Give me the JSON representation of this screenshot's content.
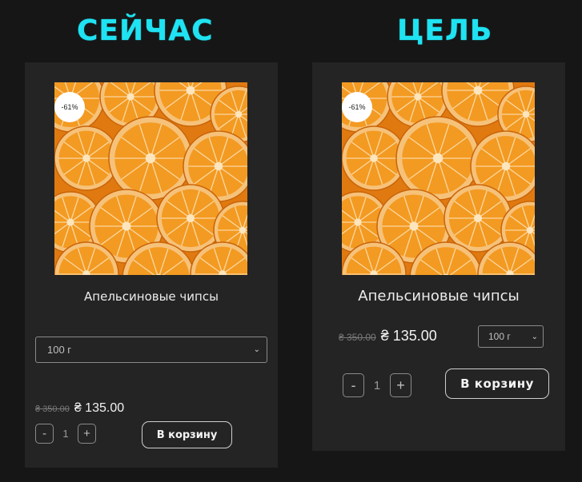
{
  "headings": {
    "now": "СЕЙЧАС",
    "goal": "ЦЕЛЬ"
  },
  "colors": {
    "background": "#161616",
    "card": "#242424",
    "heading": "#1fe3f2",
    "image_fill": "#f08a1a"
  },
  "card_now": {
    "image_icon": "dried-orange-slices-photo",
    "badge": "-61%",
    "title": "Апельсиновые чипсы",
    "select_value": "100 г",
    "old_price": "₴ 350.00",
    "new_price": "₴ 135.00",
    "minus": "-",
    "quantity": "1",
    "plus": "+",
    "cart_label": "В корзину"
  },
  "card_goal": {
    "image_icon": "dried-orange-slices-photo",
    "badge": "-61%",
    "title": "Апельсиновые чипсы",
    "select_value": "100 г",
    "old_price": "₴ 350.00",
    "new_price": "₴ 135.00",
    "minus": "-",
    "quantity": "1",
    "plus": "+",
    "cart_label": "В корзину"
  }
}
